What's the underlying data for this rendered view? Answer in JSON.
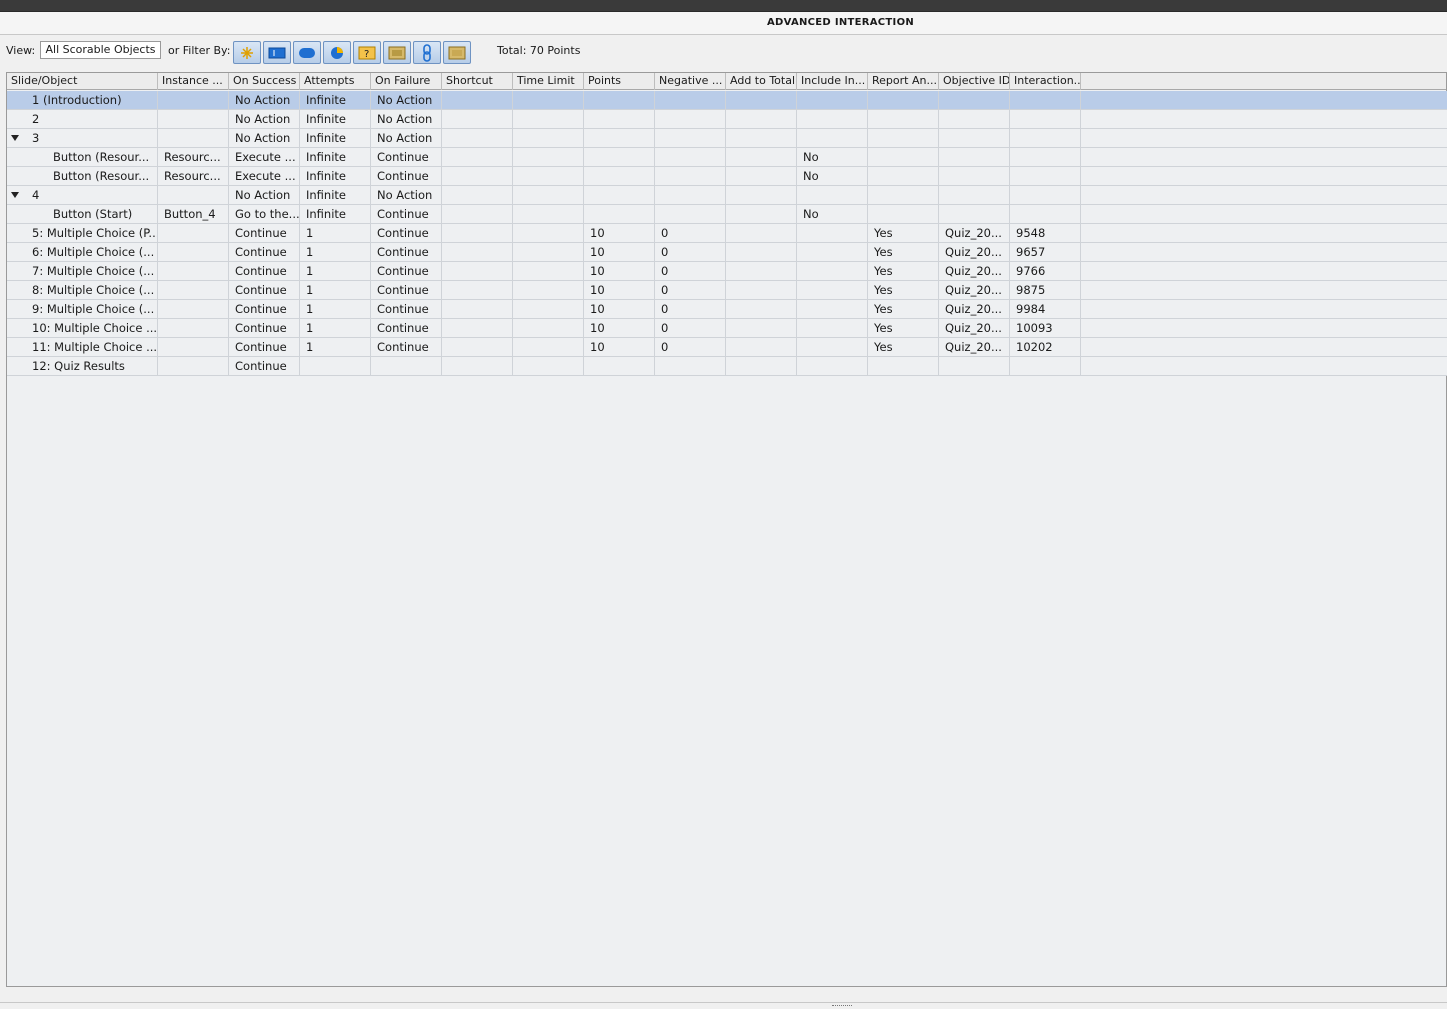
{
  "window": {
    "title": "ADVANCED INTERACTION"
  },
  "toolbar": {
    "view_label": "View:",
    "view_value": "All Scorable Objects",
    "filter_label": "or Filter By:",
    "filter_icons": [
      "click-box-icon",
      "text-entry-icon",
      "button-icon",
      "rollover-icon",
      "question-icon",
      "image-icon",
      "link-icon",
      "slide-icon"
    ],
    "total": "Total: 70 Points"
  },
  "columns": [
    "Slide/Object",
    "Instance ...",
    "On Success",
    "Attempts",
    "On Failure",
    "Shortcut",
    "Time Limit",
    "Points",
    "Negative ...",
    "Add to Total",
    "Include In...",
    "Report An...",
    "Objective ID",
    "Interaction..."
  ],
  "rows": [
    {
      "slide": "1 (Introduction)",
      "instance": "",
      "on_success": "No Action",
      "attempts": "Infinite",
      "on_failure": "No Action",
      "shortcut": "",
      "time_limit": "",
      "points": "",
      "negative": "",
      "add_total": "",
      "include": "",
      "report": "",
      "objective": "",
      "interaction": ""
    },
    {
      "slide": "2",
      "instance": "",
      "on_success": "No Action",
      "attempts": "Infinite",
      "on_failure": "No Action",
      "shortcut": "",
      "time_limit": "",
      "points": "",
      "negative": "",
      "add_total": "",
      "include": "",
      "report": "",
      "objective": "",
      "interaction": ""
    },
    {
      "slide": "3",
      "instance": "",
      "on_success": "No Action",
      "attempts": "Infinite",
      "on_failure": "No Action",
      "shortcut": "",
      "time_limit": "",
      "points": "",
      "negative": "",
      "add_total": "",
      "include": "",
      "report": "",
      "objective": "",
      "interaction": ""
    },
    {
      "slide": "Button (Resour...",
      "instance": "Resourc...",
      "on_success": "Execute ...",
      "attempts": "Infinite",
      "on_failure": "Continue",
      "shortcut": "",
      "time_limit": "",
      "points": "",
      "negative": "",
      "add_total": "",
      "include": "No",
      "report": "",
      "objective": "",
      "interaction": ""
    },
    {
      "slide": "Button (Resour...",
      "instance": "Resourc...",
      "on_success": "Execute ...",
      "attempts": "Infinite",
      "on_failure": "Continue",
      "shortcut": "",
      "time_limit": "",
      "points": "",
      "negative": "",
      "add_total": "",
      "include": "No",
      "report": "",
      "objective": "",
      "interaction": ""
    },
    {
      "slide": "4",
      "instance": "",
      "on_success": "No Action",
      "attempts": "Infinite",
      "on_failure": "No Action",
      "shortcut": "",
      "time_limit": "",
      "points": "",
      "negative": "",
      "add_total": "",
      "include": "",
      "report": "",
      "objective": "",
      "interaction": ""
    },
    {
      "slide": "Button (Start)",
      "instance": "Button_4",
      "on_success": "Go to the...",
      "attempts": "Infinite",
      "on_failure": "Continue",
      "shortcut": "",
      "time_limit": "",
      "points": "",
      "negative": "",
      "add_total": "",
      "include": "No",
      "report": "",
      "objective": "",
      "interaction": ""
    },
    {
      "slide": "5: Multiple Choice (P...",
      "instance": "",
      "on_success": "Continue",
      "attempts": "1",
      "on_failure": "Continue",
      "shortcut": "",
      "time_limit": "",
      "points": "10",
      "negative": "0",
      "add_total": "",
      "include": "",
      "report": "Yes",
      "objective": "Quiz_20...",
      "interaction": "9548"
    },
    {
      "slide": "6: Multiple Choice (...",
      "instance": "",
      "on_success": "Continue",
      "attempts": "1",
      "on_failure": "Continue",
      "shortcut": "",
      "time_limit": "",
      "points": "10",
      "negative": "0",
      "add_total": "",
      "include": "",
      "report": "Yes",
      "objective": "Quiz_20...",
      "interaction": "9657"
    },
    {
      "slide": "7: Multiple Choice (...",
      "instance": "",
      "on_success": "Continue",
      "attempts": "1",
      "on_failure": "Continue",
      "shortcut": "",
      "time_limit": "",
      "points": "10",
      "negative": "0",
      "add_total": "",
      "include": "",
      "report": "Yes",
      "objective": "Quiz_20...",
      "interaction": "9766"
    },
    {
      "slide": "8: Multiple Choice (...",
      "instance": "",
      "on_success": "Continue",
      "attempts": "1",
      "on_failure": "Continue",
      "shortcut": "",
      "time_limit": "",
      "points": "10",
      "negative": "0",
      "add_total": "",
      "include": "",
      "report": "Yes",
      "objective": "Quiz_20...",
      "interaction": "9875"
    },
    {
      "slide": "9: Multiple Choice (...",
      "instance": "",
      "on_success": "Continue",
      "attempts": "1",
      "on_failure": "Continue",
      "shortcut": "",
      "time_limit": "",
      "points": "10",
      "negative": "0",
      "add_total": "",
      "include": "",
      "report": "Yes",
      "objective": "Quiz_20...",
      "interaction": "9984"
    },
    {
      "slide": "10: Multiple Choice ...",
      "instance": "",
      "on_success": "Continue",
      "attempts": "1",
      "on_failure": "Continue",
      "shortcut": "",
      "time_limit": "",
      "points": "10",
      "negative": "0",
      "add_total": "",
      "include": "",
      "report": "Yes",
      "objective": "Quiz_20...",
      "interaction": "10093"
    },
    {
      "slide": "11: Multiple Choice ...",
      "instance": "",
      "on_success": "Continue",
      "attempts": "1",
      "on_failure": "Continue",
      "shortcut": "",
      "time_limit": "",
      "points": "10",
      "negative": "0",
      "add_total": "",
      "include": "",
      "report": "Yes",
      "objective": "Quiz_20...",
      "interaction": "10202"
    },
    {
      "slide": "12: Quiz Results",
      "instance": "",
      "on_success": "Continue",
      "attempts": "",
      "on_failure": "",
      "shortcut": "",
      "time_limit": "",
      "points": "",
      "negative": "",
      "add_total": "",
      "include": "",
      "report": "",
      "objective": "",
      "interaction": ""
    }
  ],
  "colors": {
    "selected_row": "#b9cce8",
    "grid_bg": "#eef0f2",
    "header_bg": "#ececec"
  }
}
